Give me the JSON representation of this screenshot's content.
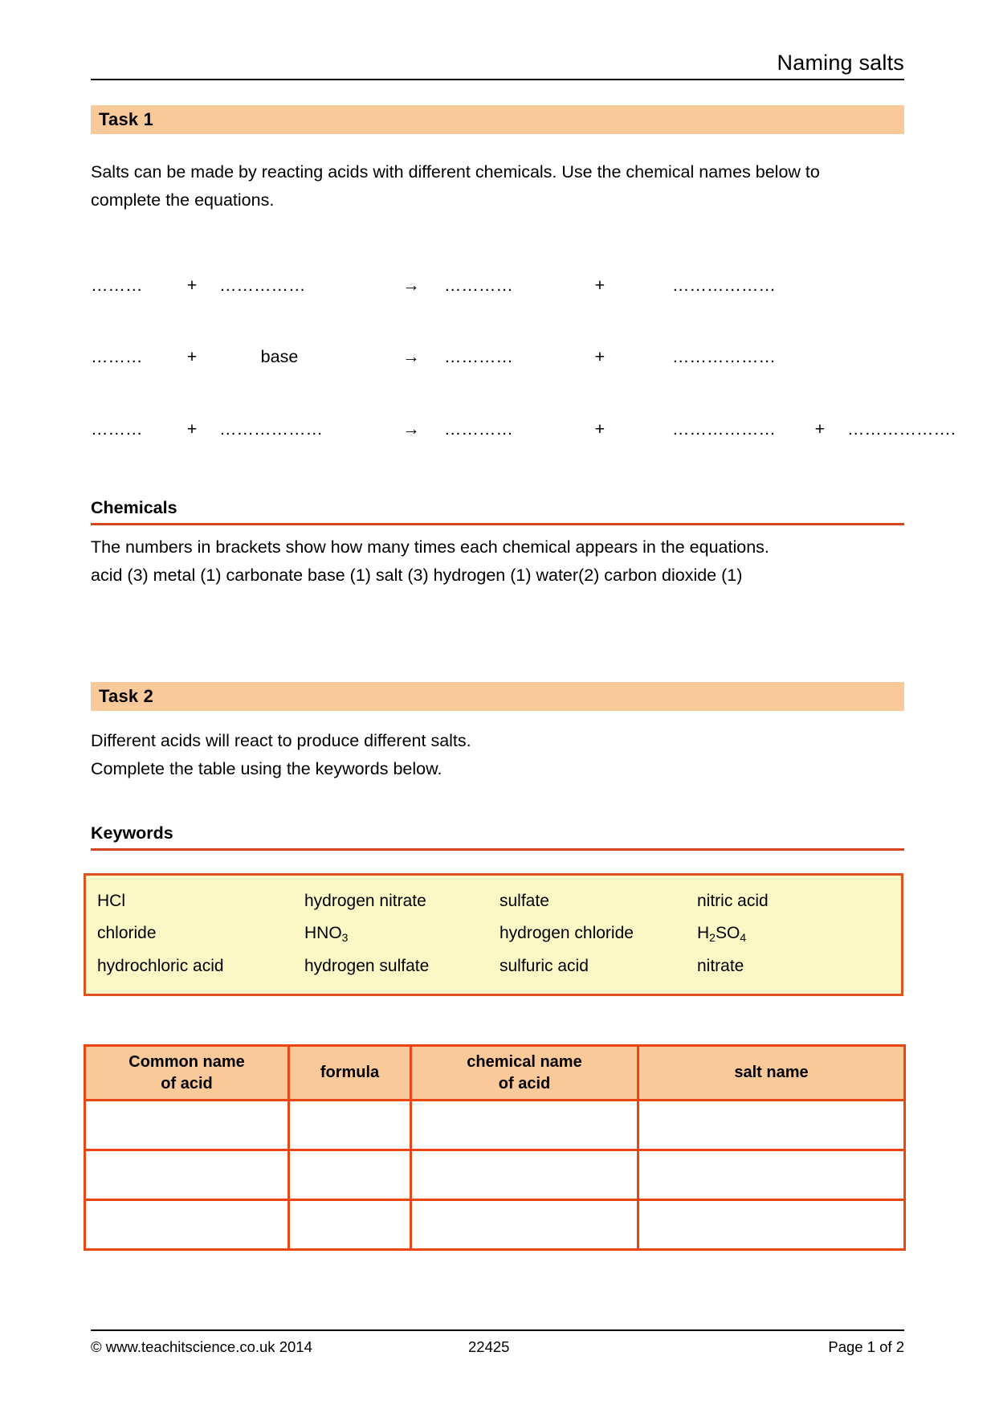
{
  "header": {
    "title": "Naming salts"
  },
  "task1": {
    "bar_label": "Task 1",
    "intro": "Salts can be made by reacting acids with different chemicals.  Use the chemical names below to complete the equations.",
    "equations": [
      {
        "t1": "………",
        "op1": "+",
        "t2": "……………",
        "arrow": "→",
        "t3": "…………",
        "op2": "+",
        "t4": "………………"
      },
      {
        "t1": "………",
        "op1": "+",
        "t2": "base",
        "arrow": "→",
        "t3": "…………",
        "op2": "+",
        "t4": "………………"
      },
      {
        "t1": "………",
        "op1": "+",
        "t2": "………………",
        "arrow": "→",
        "t3": "…………",
        "op2": "+",
        "t4": "………………",
        "op3": "+",
        "t5": "………………."
      }
    ]
  },
  "chemicals": {
    "heading": "Chemicals",
    "note": "The numbers in brackets show how many times each chemical appears in the equations.",
    "list": "acid (3)  metal (1)   carbonate base (1)   salt (3)    hydrogen (1)   water(2)   carbon dioxide (1)"
  },
  "task2": {
    "bar_label": "Task 2",
    "intro_line1": "Different acids will react to produce different salts.",
    "intro_line2": "Complete the table using the keywords below."
  },
  "keywords": {
    "heading": "Keywords",
    "rows": [
      [
        {
          "text": "HCl"
        },
        {
          "text": "hydrogen nitrate"
        },
        {
          "text": "sulfate"
        },
        {
          "text": "nitric acid"
        }
      ],
      [
        {
          "text": "chloride"
        },
        {
          "base": "HNO",
          "sub": "3"
        },
        {
          "text": "hydrogen chloride"
        },
        {
          "base": "H",
          "sub": "2",
          "base2": "SO",
          "sub2": "4"
        }
      ],
      [
        {
          "text": "hydrochloric acid"
        },
        {
          "text": "hydrogen sulfate"
        },
        {
          "text": "sulfuric acid"
        },
        {
          "text": "nitrate"
        }
      ]
    ]
  },
  "salt_table": {
    "headers": [
      {
        "line1": "Common name",
        "line2": "of acid"
      },
      {
        "line1": "formula",
        "line2": ""
      },
      {
        "line1": "chemical name",
        "line2": "of acid"
      },
      {
        "line1": "salt name",
        "line2": ""
      }
    ],
    "rows": [
      [
        "",
        "",
        "",
        ""
      ],
      [
        "",
        "",
        "",
        ""
      ],
      [
        "",
        "",
        "",
        ""
      ]
    ]
  },
  "footer": {
    "copyright": "© www.teachitscience.co.uk 2014",
    "doc_id": "22425",
    "page": "Page 1 of 2"
  },
  "colors": {
    "task_bar": "#fac99a",
    "rule": "#d4451c",
    "table_border": "#ea4512",
    "keywords_bg": "#fcf8c5"
  }
}
